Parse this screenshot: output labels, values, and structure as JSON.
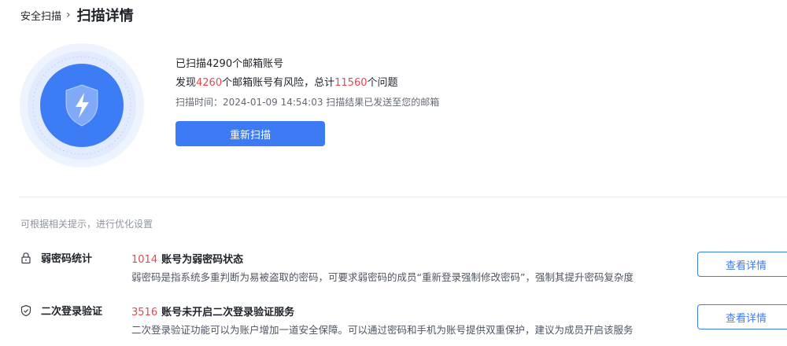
{
  "breadcrumb": {
    "parent": "安全扫描",
    "separator": "›",
    "current": "扫描详情"
  },
  "summary": {
    "line1": "已扫描4290个邮箱账号",
    "line2_prefix": "发现",
    "risk_accounts": "4260",
    "line2_middle": "个邮箱账号有风险，总计",
    "total_issues": "11560",
    "line2_suffix": "个问题",
    "scan_time_label": "扫描时间：",
    "scan_time": "2024-01-09 14:54:03",
    "scan_result_note": "扫描结果已发送至您的邮箱",
    "rescan_label": "重新扫描"
  },
  "tip": "可根据相关提示，进行优化设置",
  "items": [
    {
      "icon": "lock-icon",
      "name": "弱密码统计",
      "count": "1014",
      "title": "账号为弱密码状态",
      "description": "弱密码是指系统多重判断为易被盗取的密码，可要求弱密码的成员“重新登录强制修改密码”，强制其提升密码复杂度",
      "action_label": "查看详情"
    },
    {
      "icon": "shield-check-icon",
      "name": "二次登录验证",
      "count": "3516",
      "title": "账号未开启二次登录验证服务",
      "description": "二次登录验证功能可以为账户增加一道安全保障。可以通过密码和手机为账号提供双重保护，建议为成员开启该服务",
      "action_label": "查看详情"
    }
  ],
  "colors": {
    "accent": "#3d7bf5",
    "danger": "#e5484d",
    "muted": "#8f959e"
  }
}
